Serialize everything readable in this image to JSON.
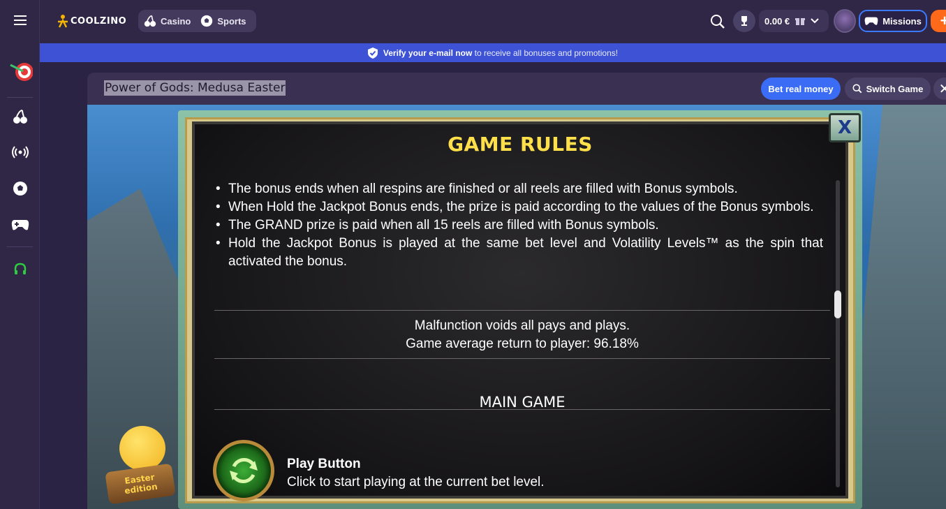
{
  "header": {
    "logo_text": "COOLZINO",
    "nav": [
      {
        "label": "Casino",
        "icon": "cherry-icon"
      },
      {
        "label": "Sports",
        "icon": "soccer-ball-icon"
      }
    ],
    "balance": "0.00 €",
    "missions_label": "Missions",
    "plus_label": "+"
  },
  "banner": {
    "bold_text": "Verify your e-mail now",
    "text": "to receive all bonuses and promotions!"
  },
  "sidebar": {
    "items": [
      {
        "icon": "menu-icon"
      },
      {
        "icon": "darts-target-icon"
      },
      {
        "icon": "cherry-icon"
      },
      {
        "icon": "live-broadcast-icon"
      },
      {
        "icon": "soccer-ball-icon"
      },
      {
        "icon": "gamepad-icon"
      },
      {
        "icon": "support-headset-icon"
      }
    ]
  },
  "game": {
    "title": "Power of Gods: Medusa Easter",
    "bet_real_label": "Bet real money",
    "switch_label": "Switch Game",
    "close_label": "✕"
  },
  "rules": {
    "title": "GAME RULES",
    "close_label": "X",
    "bullets": [
      "The bonus ends when all respins are finished or all reels are filled with Bonus symbols.",
      "When Hold the Jackpot Bonus ends, the prize is paid according to the values of the Bonus symbols.",
      "The GRAND prize is paid when all 15 reels are filled with Bonus symbols.",
      "Hold the Jackpot Bonus is played at the same bet level and Volatility Levels™ as the spin that activated the bonus."
    ],
    "note_line1": "Malfunction voids all pays and plays.",
    "note_line2": "Game average return to player: 96.18%",
    "section_title": "MAIN GAME",
    "play_title": "Play Button",
    "play_desc": "Click to start playing at the current bet level."
  },
  "easter": {
    "line1": "Easter",
    "line2": "edition"
  },
  "colors": {
    "accent_blue": "#3b6cf6",
    "banner_blue": "#3d52d5",
    "orange": "#ff6a1a",
    "rules_title_yellow": "#ffe04a"
  }
}
